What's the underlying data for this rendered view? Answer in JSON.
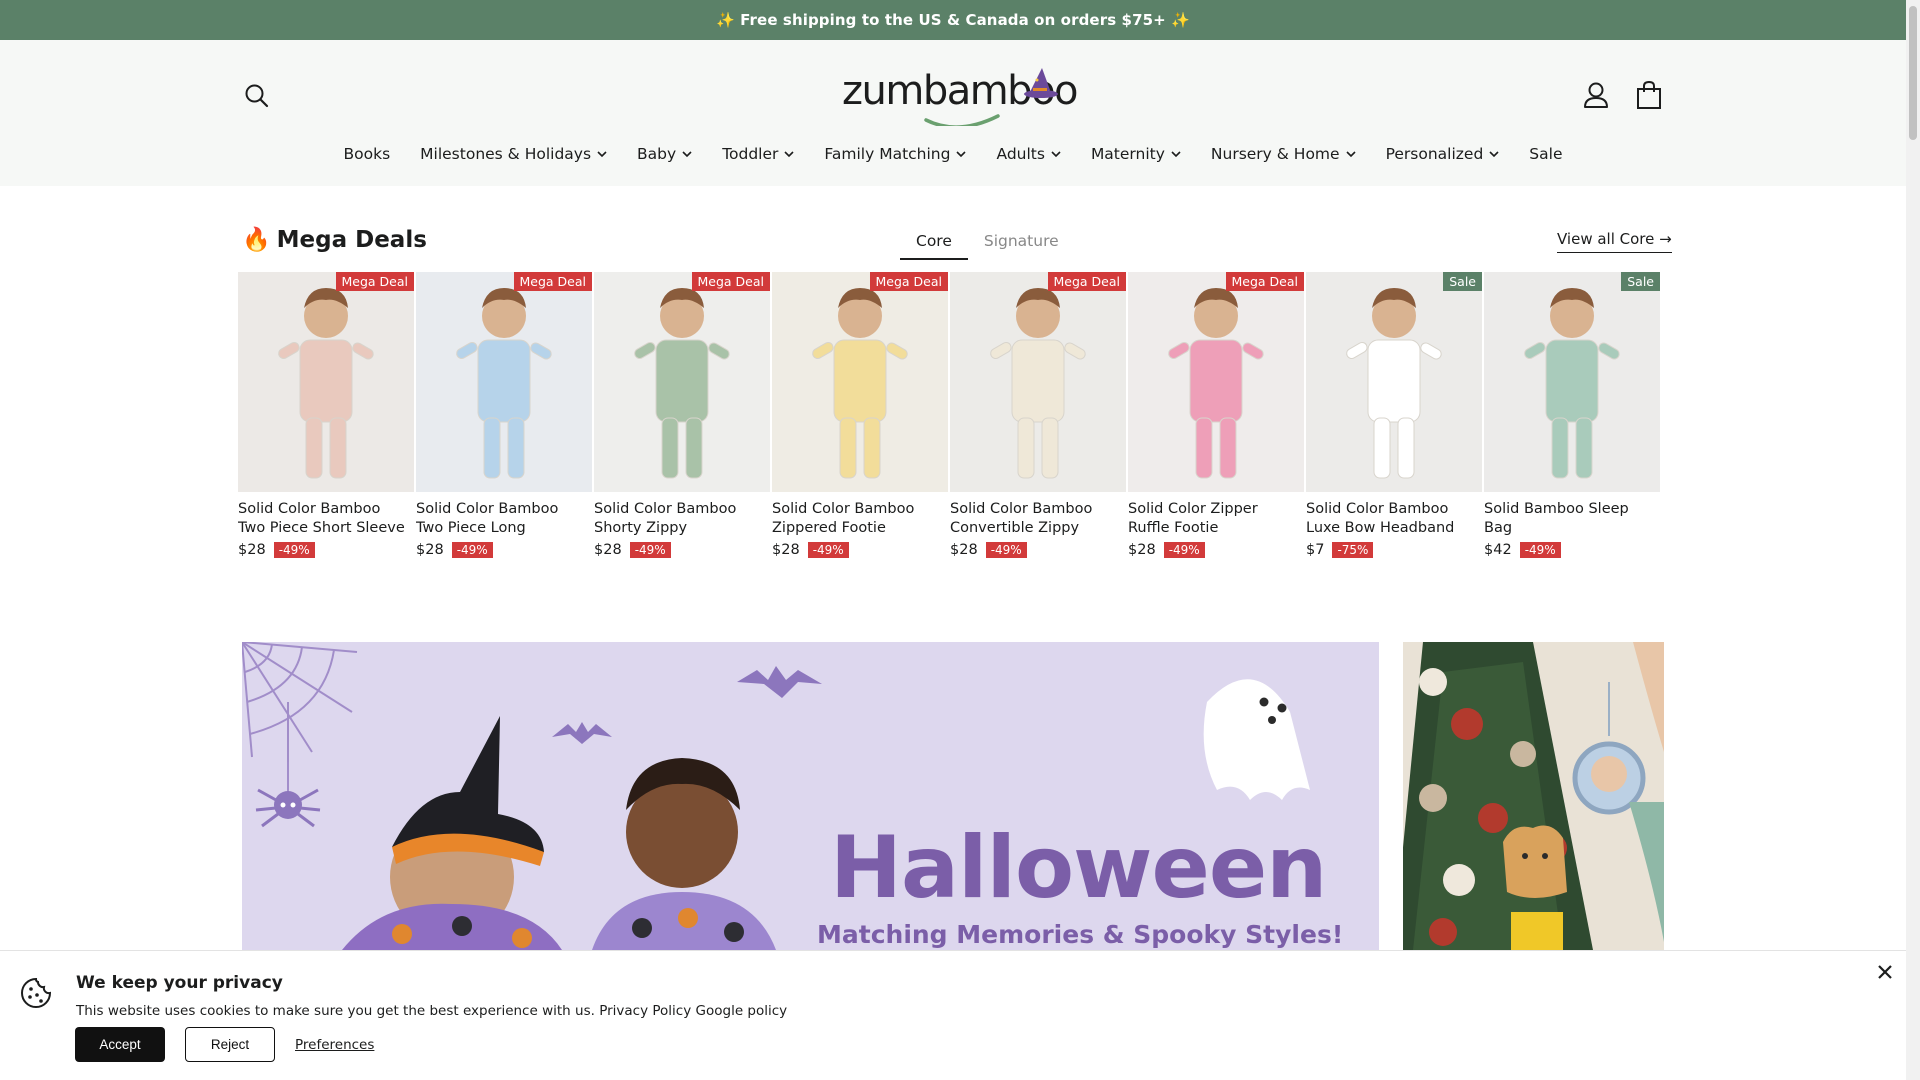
{
  "announcement": {
    "text": "✨ Free shipping to the US & Canada on orders $75+ ✨"
  },
  "header": {
    "logo_text": "zumbamboo",
    "icons": {
      "search": "search-icon",
      "account": "account-icon",
      "cart": "cart-icon"
    }
  },
  "nav": {
    "items": [
      {
        "label": "Books",
        "has_dropdown": false
      },
      {
        "label": "Milestones & Holidays",
        "has_dropdown": true
      },
      {
        "label": "Baby",
        "has_dropdown": true
      },
      {
        "label": "Toddler",
        "has_dropdown": true
      },
      {
        "label": "Family Matching",
        "has_dropdown": true
      },
      {
        "label": "Adults",
        "has_dropdown": true
      },
      {
        "label": "Maternity",
        "has_dropdown": true
      },
      {
        "label": "Nursery & Home",
        "has_dropdown": true
      },
      {
        "label": "Personalized",
        "has_dropdown": true
      },
      {
        "label": "Sale",
        "has_dropdown": false
      }
    ]
  },
  "deals": {
    "emoji": "🔥",
    "title": "Mega Deals",
    "tabs": [
      {
        "label": "Core",
        "active": true
      },
      {
        "label": "Signature",
        "active": false
      }
    ],
    "view_all": "View all Core →",
    "products": [
      {
        "name": "Solid Color Bamboo Two Piece Short Sleeve Shor...",
        "price": "$28",
        "discount": "-49%",
        "badge": "Mega Deal",
        "badge_type": "mega",
        "bg": "#ece9e6",
        "cloth": "#e9c9be"
      },
      {
        "name": "Solid Color Bamboo Two Piece Long Sleeve...",
        "price": "$28",
        "discount": "-49%",
        "badge": "Mega Deal",
        "badge_type": "mega",
        "bg": "#e8ebef",
        "cloth": "#b6d3ea"
      },
      {
        "name": "Solid Color Bamboo Shorty Zippy",
        "price": "$28",
        "discount": "-49%",
        "badge": "Mega Deal",
        "badge_type": "mega",
        "bg": "#eeeeec",
        "cloth": "#a9c2a8"
      },
      {
        "name": "Solid Color Bamboo Zippered Footie Romper",
        "price": "$28",
        "discount": "-49%",
        "badge": "Mega Deal",
        "badge_type": "mega",
        "bg": "#efece4",
        "cloth": "#f2dd9a"
      },
      {
        "name": "Solid Color Bamboo Convertible Zippy",
        "price": "$28",
        "discount": "-49%",
        "badge": "Mega Deal",
        "badge_type": "mega",
        "bg": "#ecebe8",
        "cloth": "#efe8d8"
      },
      {
        "name": "Solid Color Zipper Ruffle Footie",
        "price": "$28",
        "discount": "-49%",
        "badge": "Mega Deal",
        "badge_type": "mega",
        "bg": "#efeceb",
        "cloth": "#ee9fb8"
      },
      {
        "name": "Solid Color Bamboo Luxe Bow Headband",
        "price": "$7",
        "discount": "-75%",
        "badge": "Sale",
        "badge_type": "sale",
        "bg": "#ecebe9",
        "cloth": "#ffffff"
      },
      {
        "name": "Solid Bamboo Sleep Bag",
        "price": "$42",
        "discount": "-49%",
        "badge": "Sale",
        "badge_type": "sale",
        "bg": "#ecebea",
        "cloth": "#a9cbbb"
      }
    ]
  },
  "hero": {
    "title": "Halloween",
    "subtitle": "Matching Memories & Spooky Styles!"
  },
  "cookie": {
    "title": "We keep your privacy",
    "text": "This website uses cookies to make sure you get the best experience with us.",
    "privacy_link": "Privacy Policy",
    "google_link": "Google policy",
    "accept": "Accept",
    "reject": "Reject",
    "preferences": "Preferences"
  },
  "colors": {
    "brand_green": "#5b8168",
    "deal_red": "#d23a3a",
    "halloween_purple": "#7b5ea8"
  }
}
